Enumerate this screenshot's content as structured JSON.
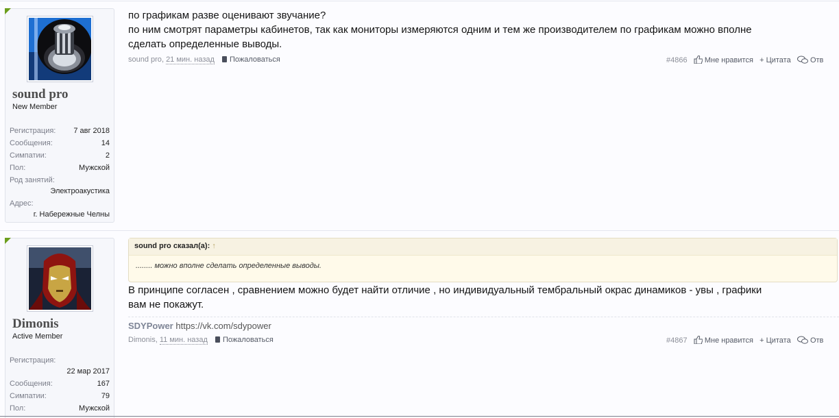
{
  "posts": [
    {
      "user": {
        "name": "sound pro",
        "title": "New Member",
        "reg_label": "Регистрация:",
        "reg_value": "7 авг 2018",
        "messages_label": "Сообщения:",
        "messages_value": "14",
        "likes_label": "Симпатии:",
        "likes_value": "2",
        "gender_label": "Пол:",
        "gender_value": "Мужской",
        "occupation_label": "Род занятий:",
        "occupation_value": "Электроакустика",
        "address_label": "Адрес:",
        "address_value": "г. Набережные Челны",
        "avatar": "speaker-avatar"
      },
      "lines": [
        "по графикам разве оценивают звучание?",
        "по ним смотрят параметры кабинетов, так как мониторы измеряются одним и тем же производителем по графикам можно вполне",
        "сделать определенные выводы."
      ],
      "meta": {
        "author": "sound pro",
        "time": "21 мин. назад",
        "report": "Пожаловаться",
        "number": "#4866",
        "like": "Мне нравится",
        "quote": "+ Цитата",
        "reply": "Отв"
      }
    },
    {
      "user": {
        "name": "Dimonis",
        "title": "Active Member",
        "reg_label": "Регистрация:",
        "reg_value": "22 мар 2017",
        "messages_label": "Сообщения:",
        "messages_value": "167",
        "likes_label": "Симпатии:",
        "likes_value": "79",
        "gender_label": "Пол:",
        "gender_value": "Мужской",
        "avatar": "iron-man-avatar"
      },
      "quote": {
        "head": "sound pro сказал(а):",
        "arrow": "↑",
        "text": "........ можно вполне сделать определенные выводы."
      },
      "lines": [
        "В принципе согласен , сравнением можно будет найти отличие , но индивидуальный тембральный окрас динамиков - увы , графики",
        "вам не покажут."
      ],
      "signature": {
        "name": "SDYPower",
        "link": "https://vk.com/sdypower"
      },
      "meta": {
        "author": "Dimonis",
        "time": "11 мин. назад",
        "report": "Пожаловаться",
        "number": "#4867",
        "like": "Мне нравится",
        "quote": "+ Цитата",
        "reply": "Отв"
      }
    }
  ]
}
